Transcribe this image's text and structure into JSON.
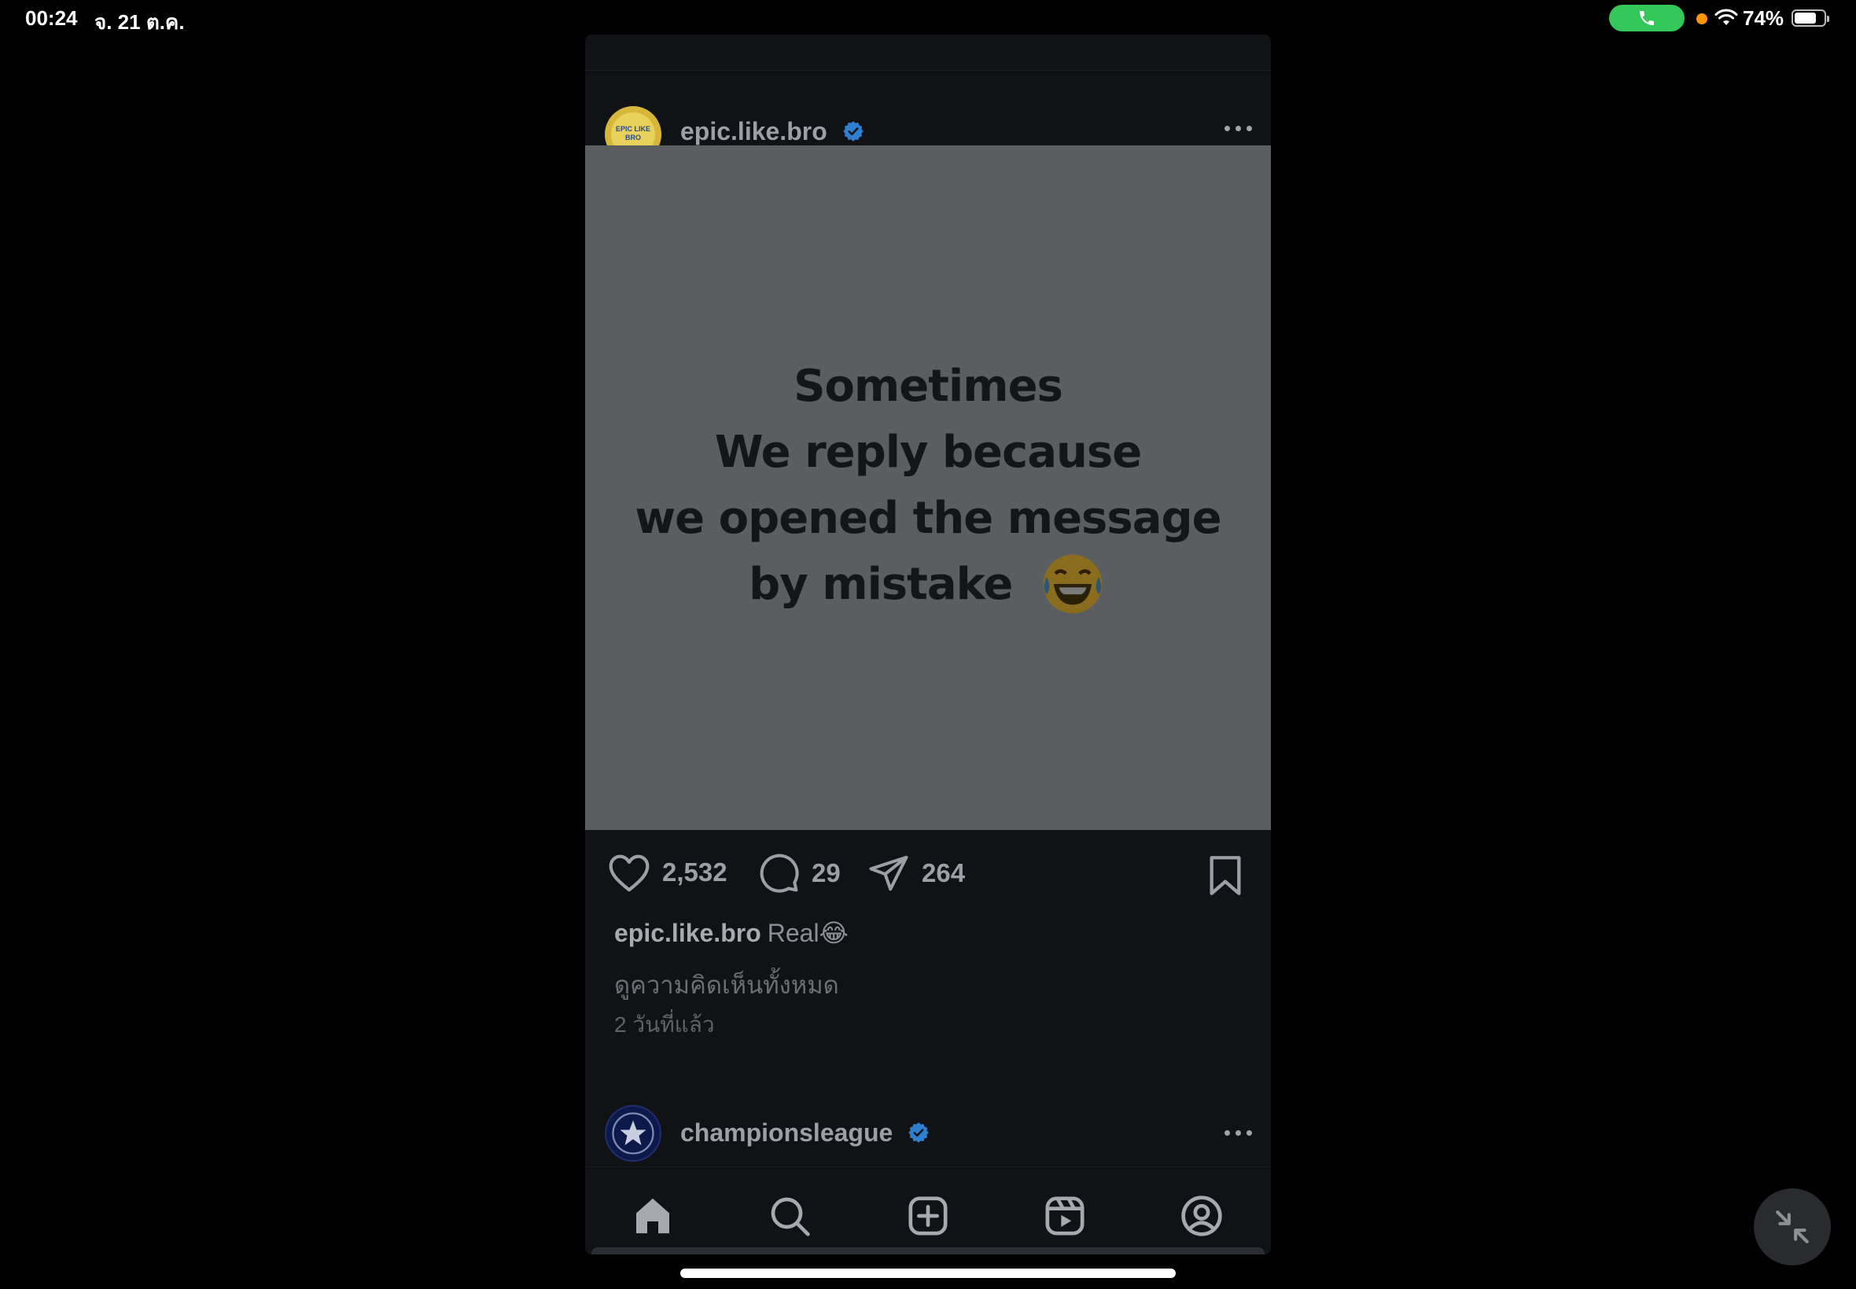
{
  "status_bar": {
    "time": "00:24",
    "date": "จ. 21 ต.ค.",
    "battery_pct": "74%",
    "battery_level": 0.74,
    "call_color": "#34c759",
    "indicator_color": "#ff9500"
  },
  "post": {
    "username": "epic.like.bro",
    "verified": true,
    "avatar_text": "EPIC LIKE BRO",
    "image_text": [
      "Sometimes",
      "We reply because",
      "we opened the message",
      "by mistake"
    ],
    "image_emoji": "😂",
    "likes": "2,532",
    "comments": "29",
    "shares": "264",
    "caption_user": "epic.like.bro",
    "caption_text": "Real😂",
    "view_comments": "ดูความคิดเห็นทั้งหมด",
    "time_ago": "2 วันที่แล้ว"
  },
  "next_post": {
    "username": "championsleague",
    "verified": true
  },
  "nav": {
    "items": [
      "home-icon",
      "search-icon",
      "create-icon",
      "reels-icon",
      "profile-icon"
    ]
  },
  "colors": {
    "verified_blue": "#3897f0",
    "app_bg": "#101215",
    "image_bg": "#5b5e61"
  }
}
